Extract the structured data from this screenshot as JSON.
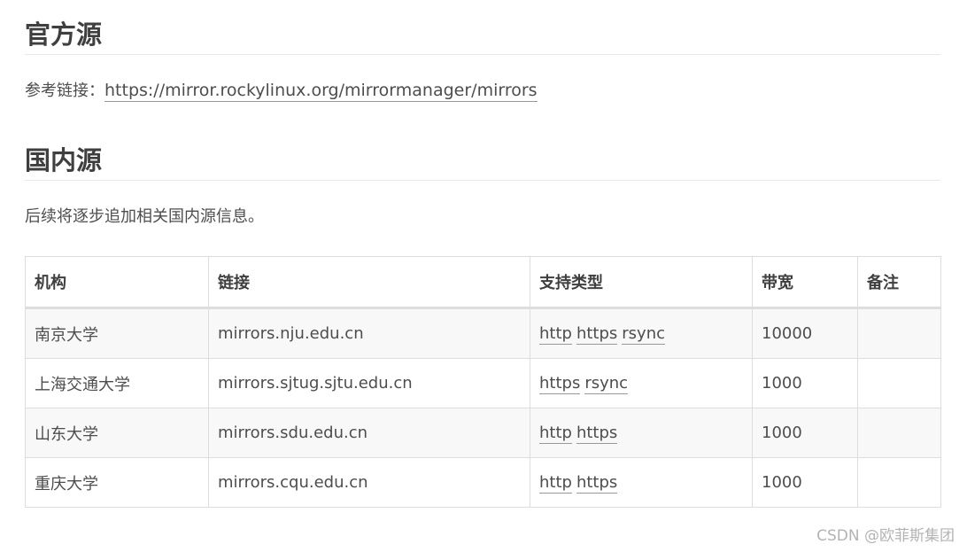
{
  "official": {
    "heading": "官方源",
    "ref_prefix": "参考链接：",
    "ref_link": "https://mirror.rockylinux.org/mirrormanager/mirrors"
  },
  "domestic": {
    "heading": "国内源",
    "note": "后续将逐步追加相关国内源信息。"
  },
  "table": {
    "headers": [
      "机构",
      "链接",
      "支持类型",
      "带宽",
      "备注"
    ],
    "rows": [
      {
        "org": "南京大学",
        "link": "mirrors.nju.edu.cn",
        "types": [
          "http",
          "https",
          "rsync"
        ],
        "bandwidth": "10000",
        "note": ""
      },
      {
        "org": "上海交通大学",
        "link": "mirrors.sjtug.sjtu.edu.cn",
        "types": [
          "https",
          "rsync"
        ],
        "bandwidth": "1000",
        "note": ""
      },
      {
        "org": "山东大学",
        "link": "mirrors.sdu.edu.cn",
        "types": [
          "http",
          "https"
        ],
        "bandwidth": "1000",
        "note": ""
      },
      {
        "org": "重庆大学",
        "link": "mirrors.cqu.edu.cn",
        "types": [
          "http",
          "https"
        ],
        "bandwidth": "1000",
        "note": ""
      }
    ]
  },
  "watermark": "CSDN @欧菲斯集团"
}
